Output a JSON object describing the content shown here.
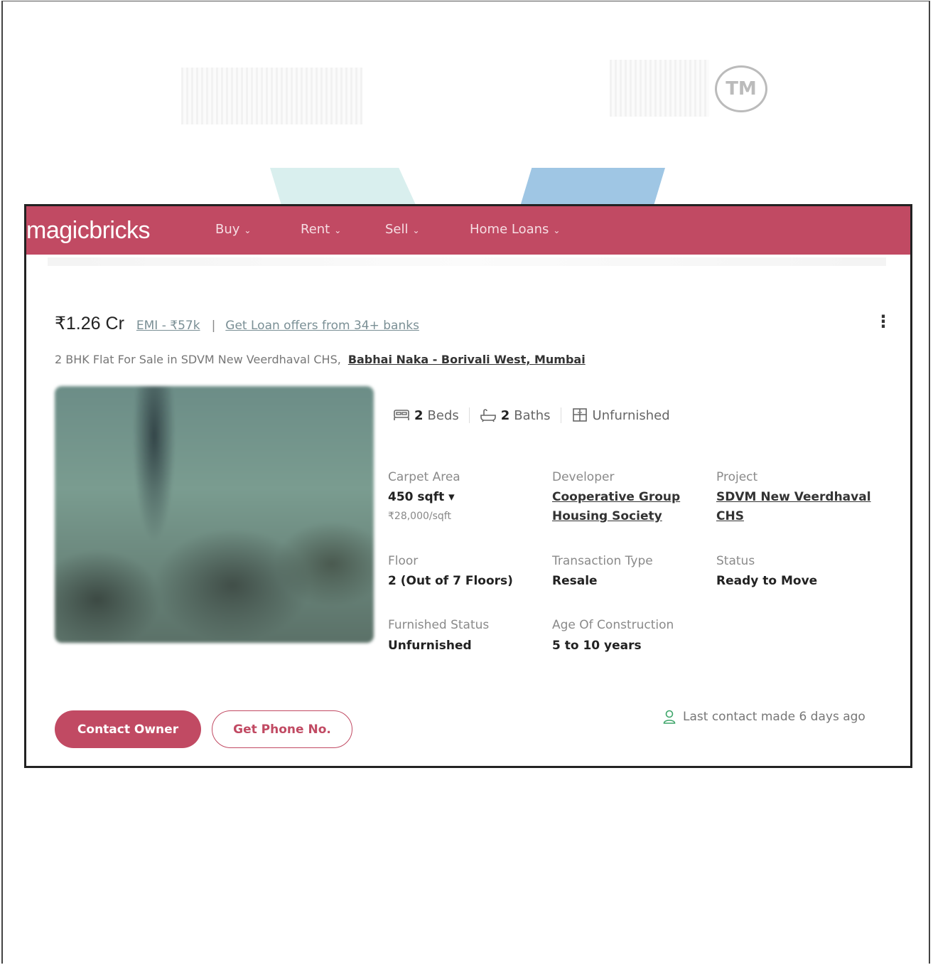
{
  "header": {
    "logo": "magicbricks",
    "nav": [
      {
        "label": "Buy"
      },
      {
        "label": "Rent"
      },
      {
        "label": "Sell"
      },
      {
        "label": "Home Loans"
      }
    ]
  },
  "listing": {
    "price": "₹1.26 Cr",
    "emi": "EMI - ₹57k",
    "separator": "|",
    "loan_offer": "Get Loan offers from 34+ banks",
    "title": "2 BHK Flat For Sale in SDVM New Veerdhaval CHS,",
    "location": "Babhai Naka - Borivali West, Mumbai",
    "features": {
      "beds_count": "2",
      "beds_label": "Beds",
      "baths_count": "2",
      "baths_label": "Baths",
      "furnishing": "Unfurnished"
    },
    "specs": {
      "carpet_area_label": "Carpet Area",
      "carpet_area_value": "450 sqft",
      "carpet_area_rate": "₹28,000/sqft",
      "developer_label": "Developer",
      "developer_line1": "Cooperative Group",
      "developer_line2": "Housing Society",
      "project_label": "Project",
      "project_line1": "SDVM New Veerdhaval",
      "project_line2": "CHS",
      "floor_label": "Floor",
      "floor_value": "2 (Out of 7 Floors)",
      "transaction_label": "Transaction Type",
      "transaction_value": "Resale",
      "status_label": "Status",
      "status_value": "Ready to Move",
      "furnished_label": "Furnished Status",
      "furnished_value": "Unfurnished",
      "age_label": "Age Of Construction",
      "age_value": "5 to 10 years"
    },
    "actions": {
      "contact_owner": "Contact Owner",
      "get_phone": "Get Phone No."
    },
    "last_contact": "Last contact made 6 days ago"
  },
  "page_mark": "TM",
  "colors": {
    "brand": "#c14a63",
    "link_muted": "#7a8f95",
    "contact_icon": "#3ea66a"
  }
}
